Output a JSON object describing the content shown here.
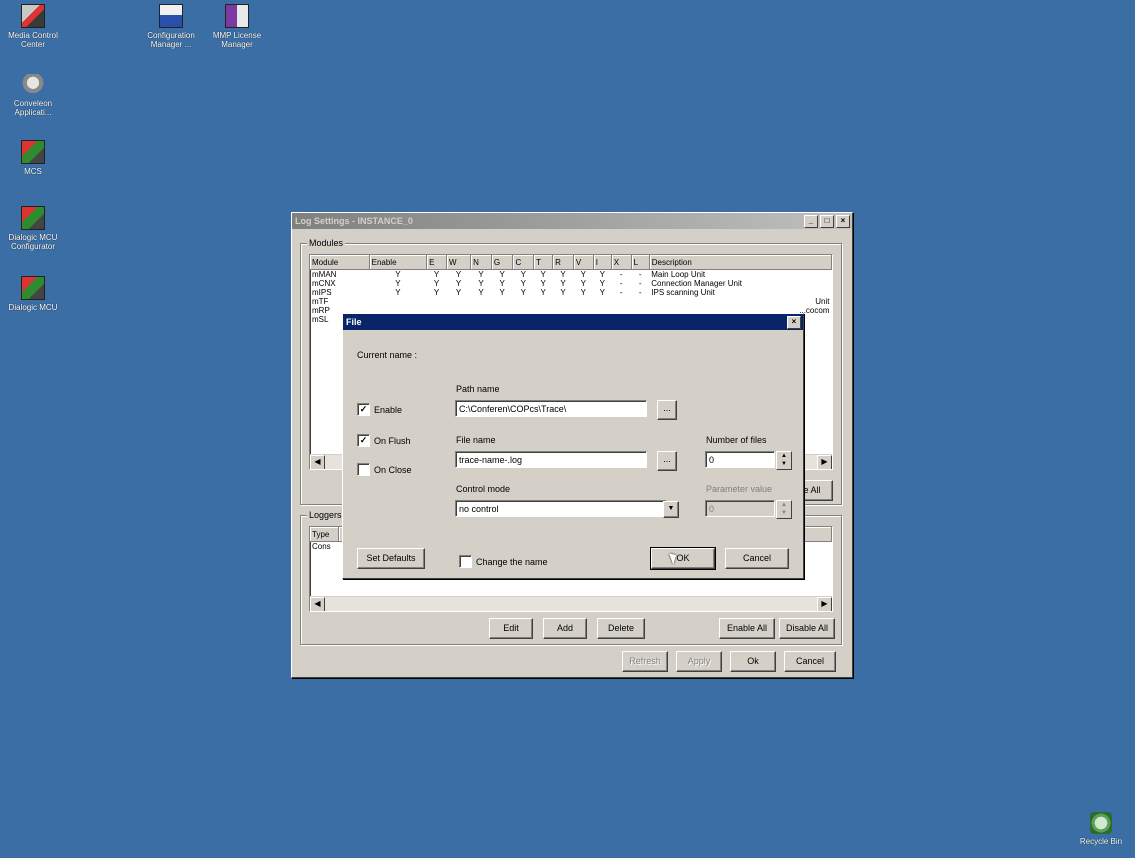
{
  "desktop": {
    "icons": [
      {
        "label": "Media Control\nCenter",
        "icon": "media-control-icon"
      },
      {
        "label": "Configuration\nManager ...",
        "icon": "configuration-manager-icon"
      },
      {
        "label": "MMP License\nManager",
        "icon": "license-manager-icon"
      },
      {
        "label": "Conveleon\nApplicati...",
        "icon": "applications-icon"
      },
      {
        "label": "MCS",
        "icon": "mcs-icon"
      },
      {
        "label": "Dialogic MCU\nConfigurator",
        "icon": "dialogic-configurator-icon"
      },
      {
        "label": "Dialogic MCU",
        "icon": "dialogic-mcu-icon"
      },
      {
        "label": "Recycle Bin",
        "icon": "recycle-bin-icon"
      }
    ]
  },
  "log_window": {
    "title": "Log Settings - INSTANCE_0",
    "modules_group": "Modules",
    "columns": [
      "Module",
      "Enable",
      "E",
      "W",
      "N",
      "G",
      "C",
      "T",
      "R",
      "V",
      "I",
      "X",
      "L",
      "Description"
    ],
    "rows": [
      [
        "mMAN",
        "Y",
        "Y",
        "Y",
        "Y",
        "Y",
        "Y",
        "Y",
        "Y",
        "Y",
        "Y",
        "-",
        "-",
        "Main Loop Unit"
      ],
      [
        "mCNX",
        "Y",
        "Y",
        "Y",
        "Y",
        "Y",
        "Y",
        "Y",
        "Y",
        "Y",
        "Y",
        "-",
        "-",
        "Connection Manager Unit"
      ],
      [
        "mIPS",
        "Y",
        "Y",
        "Y",
        "Y",
        "Y",
        "Y",
        "Y",
        "Y",
        "Y",
        "Y",
        "-",
        "-",
        "IPS scanning Unit"
      ],
      [
        "mTF",
        "",
        "",
        "",
        "",
        "",
        "",
        "",
        "",
        "",
        "",
        "",
        "",
        "Unit"
      ],
      [
        "mRP",
        "",
        "",
        "",
        "",
        "",
        "",
        "",
        "",
        "",
        "",
        "",
        "",
        "...cocom"
      ],
      [
        "mSL",
        "",
        "",
        "",
        "",
        "",
        "",
        "",
        "",
        "",
        "",
        "",
        "",
        ""
      ]
    ],
    "modules_enable_all_partial": "le All",
    "loggers_group": "Loggers",
    "loggers_columns": [
      "Type"
    ],
    "loggers_rows": [
      "Cons"
    ],
    "buttons": {
      "edit": "Edit",
      "add": "Add",
      "delete": "Delete",
      "enable_all": "Enable All",
      "disable_all": "Disable All",
      "refresh": "Refresh",
      "apply": "Apply",
      "ok": "Ok",
      "cancel": "Cancel"
    }
  },
  "file_dialog": {
    "title": "File",
    "current_name_label": "Current name :",
    "enable_label": "Enable",
    "enable_checked": true,
    "on_flush_label": "On Flush",
    "on_flush_checked": true,
    "on_close_label": "On Close",
    "on_close_checked": false,
    "path_label": "Path name",
    "path_value": "C:\\Conferen\\COPcs\\Trace\\",
    "file_label": "File name",
    "file_value": "trace-name-.log",
    "control_label": "Control mode",
    "control_value": "no control",
    "num_files_label": "Number of files",
    "num_files_value": "0",
    "param_label": "Parameter value",
    "param_value": "0",
    "browse_label": "...",
    "set_defaults": "Set Defaults",
    "change_name_label": "Change the name",
    "change_name_checked": false,
    "ok": "OK",
    "cancel": "Cancel"
  }
}
